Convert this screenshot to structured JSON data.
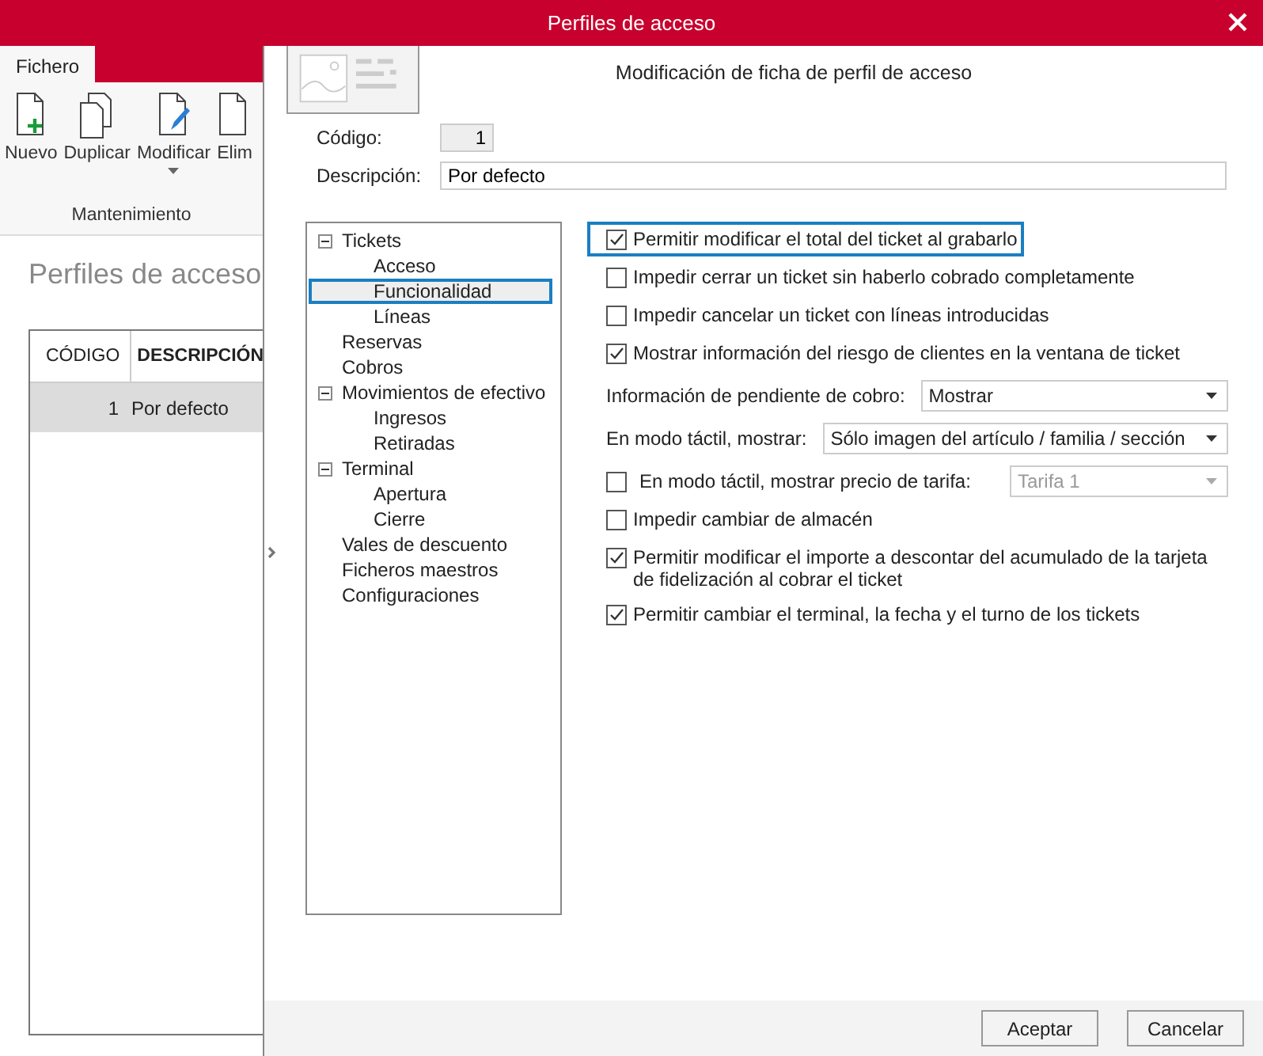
{
  "window": {
    "title": "Perfiles de acceso"
  },
  "background_app": {
    "tabs": [
      {
        "label": "Fichero",
        "selected": true
      }
    ],
    "ribbon_buttons": [
      {
        "label": "Nuevo",
        "kind": "new"
      },
      {
        "label": "Duplicar",
        "kind": "duplicate"
      },
      {
        "label": "Modificar",
        "kind": "modify",
        "dropdown": true
      },
      {
        "label": "Elim",
        "kind": "delete"
      }
    ],
    "ribbon_group": "Mantenimiento",
    "heading": "Perfiles de acceso",
    "table": {
      "columns": [
        "CÓDIGO",
        "DESCRIPCIÓN"
      ],
      "rows": [
        {
          "cells": [
            "1",
            "Por defecto"
          ],
          "selected": true
        }
      ]
    }
  },
  "dialog": {
    "heading": "Modificación de ficha de perfil de acceso",
    "fields": [
      {
        "label": "Código:",
        "value": "1",
        "kind": "readonly"
      },
      {
        "label": "Descripción:",
        "value": "Por defecto",
        "kind": "text"
      }
    ],
    "tree": [
      {
        "label": "Tickets",
        "expanded": true,
        "selected": false,
        "children": [
          {
            "label": "Acceso",
            "selected": false
          },
          {
            "label": "Funcionalidad",
            "selected": true
          },
          {
            "label": "Líneas",
            "selected": false
          }
        ]
      },
      {
        "label": "Reservas",
        "selected": false
      },
      {
        "label": "Cobros",
        "selected": false
      },
      {
        "label": "Movimientos de efectivo",
        "expanded": true,
        "selected": false,
        "children": [
          {
            "label": "Ingresos",
            "selected": false
          },
          {
            "label": "Retiradas",
            "selected": false
          }
        ]
      },
      {
        "label": "Terminal",
        "expanded": true,
        "selected": false,
        "children": [
          {
            "label": "Apertura",
            "selected": false
          },
          {
            "label": "Cierre",
            "selected": false
          }
        ]
      },
      {
        "label": "Vales de descuento",
        "selected": false
      },
      {
        "label": "Ficheros maestros",
        "selected": false
      },
      {
        "label": "Configuraciones",
        "selected": false
      }
    ],
    "options": [
      {
        "kind": "checkbox",
        "label": "Permitir modificar el total del ticket al grabarlo",
        "checked": true,
        "focused": true
      },
      {
        "kind": "checkbox",
        "label": "Impedir cerrar un ticket sin haberlo cobrado completamente",
        "checked": false,
        "focused": false
      },
      {
        "kind": "checkbox",
        "label": "Impedir cancelar un ticket con líneas introducidas",
        "checked": false,
        "focused": false
      },
      {
        "kind": "checkbox",
        "label": "Mostrar información del riesgo de clientes en la ventana de ticket",
        "checked": true,
        "focused": false
      },
      {
        "kind": "select",
        "label": "Información de pendiente de cobro:",
        "value": "Mostrar",
        "disabled": false
      },
      {
        "kind": "select",
        "label": "En modo táctil, mostrar:",
        "value": "Sólo imagen del artículo / familia / sección",
        "disabled": false
      },
      {
        "kind": "checkbox_select",
        "label": "En modo táctil, mostrar precio de tarifa:",
        "checked": false,
        "value": "Tarifa 1",
        "disabled": true
      },
      {
        "kind": "checkbox",
        "label": "Impedir cambiar de almacén",
        "checked": false,
        "focused": false
      },
      {
        "kind": "checkbox",
        "label": "Permitir modificar el importe a descontar del acumulado de la tarjeta de fidelización al cobrar el ticket",
        "checked": true,
        "focused": false
      },
      {
        "kind": "checkbox",
        "label": "Permitir cambiar el terminal, la fecha y el turno de los tickets",
        "checked": true,
        "focused": false
      }
    ],
    "buttons": [
      "Aceptar",
      "Cancelar"
    ]
  }
}
